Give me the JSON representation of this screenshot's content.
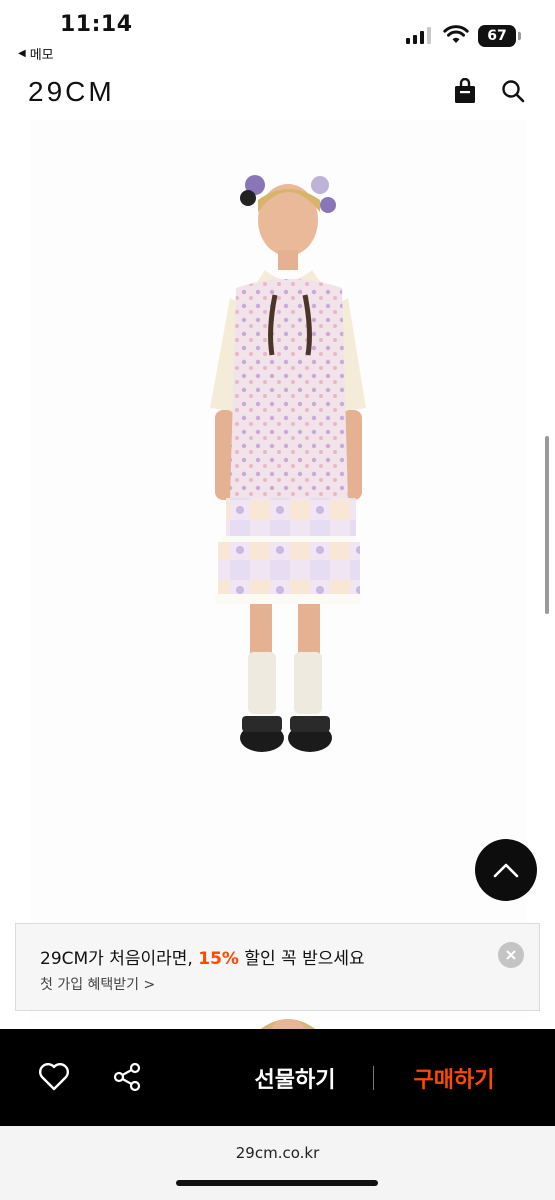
{
  "status_bar": {
    "time": "11:14",
    "back_app_label": "메모",
    "battery": "67"
  },
  "header": {
    "logo": "29CM",
    "bag_icon": "shopping-bag-icon",
    "search_icon": "search-icon"
  },
  "hero": {
    "image": "product-model-photo"
  },
  "scroll_top": {
    "icon": "chevron-up-icon"
  },
  "promo": {
    "text_before": "29CM가 처음이라면, ",
    "highlight": "15%",
    "text_after": " 할인 꼭 받으세요",
    "sub": "첫 가입 혜택받기 >",
    "close_icon": "close-icon",
    "highlight_color": "#ff4800"
  },
  "bottom_bar": {
    "heart_icon": "heart-icon",
    "share_icon": "share-icon",
    "gift_label": "선물하기",
    "buy_label": "구매하기",
    "buy_color": "#ff4800"
  },
  "browser": {
    "url": "29cm.co.kr"
  }
}
